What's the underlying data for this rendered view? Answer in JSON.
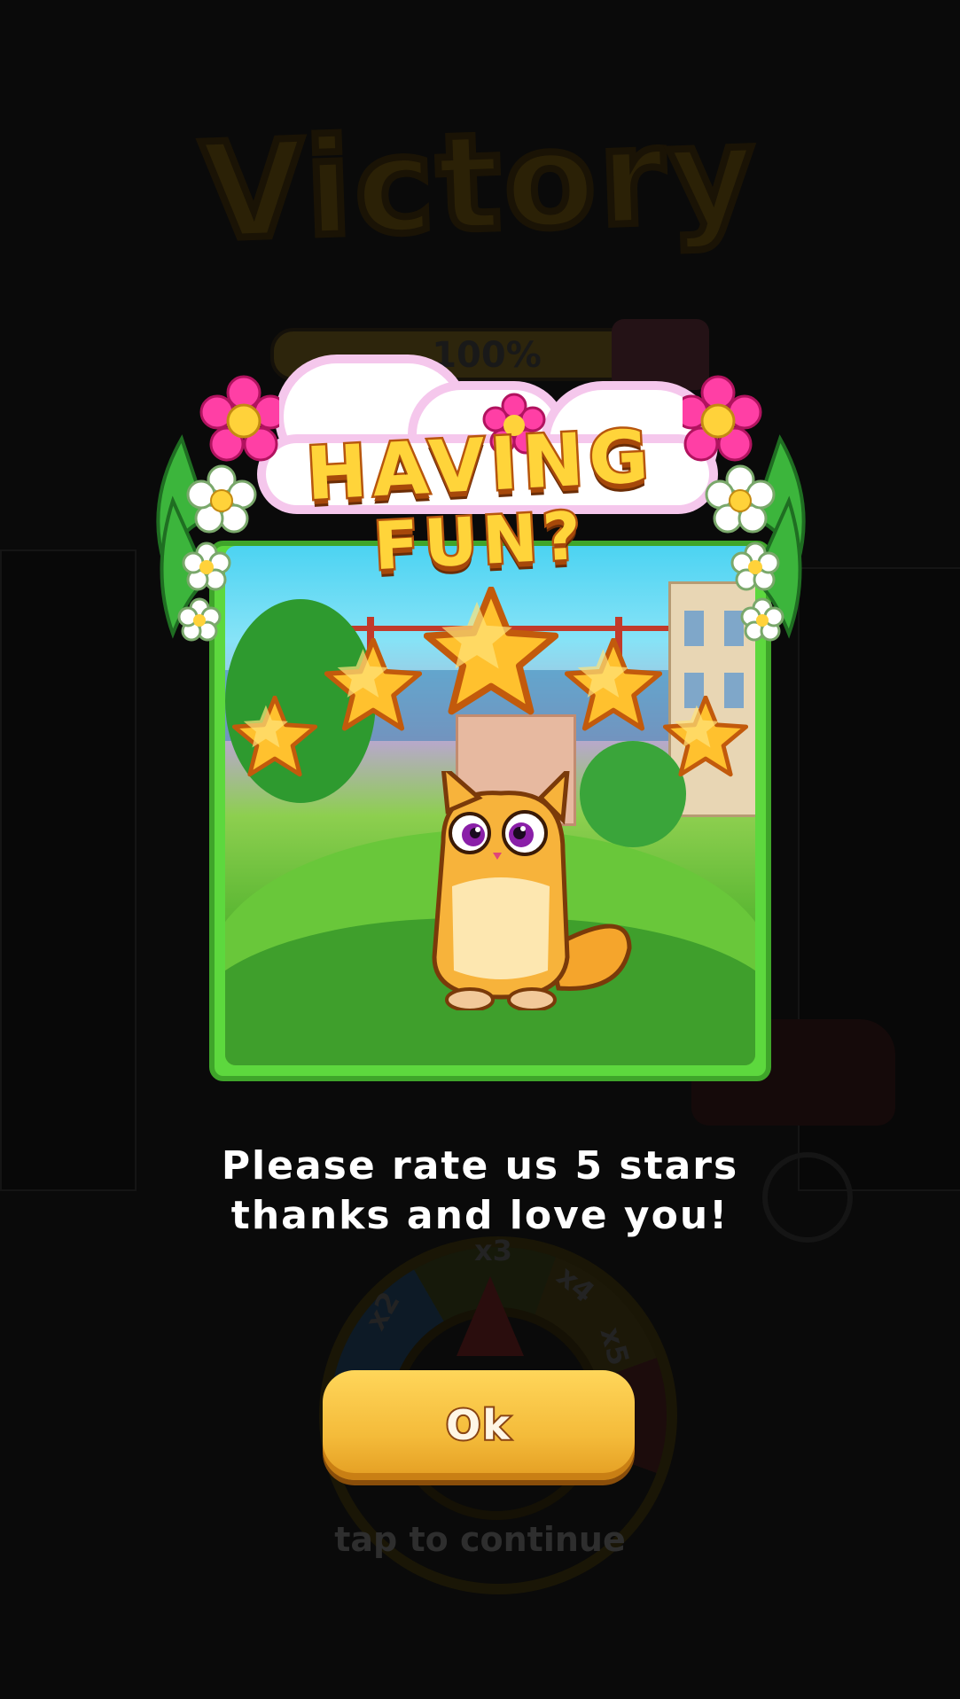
{
  "background": {
    "title": "Victory",
    "progress_label": "100%",
    "progress_value": 1.0,
    "wheel_labels": [
      "x2",
      "x3",
      "x4",
      "x5"
    ],
    "tap_hint": "tap to continue"
  },
  "popup": {
    "title_line_1": "HAVING",
    "title_line_2": "FUN?",
    "rating_stars": 5,
    "message_line_1": "Please rate us 5 stars",
    "message_line_2": "thanks and love you!",
    "ok_label": "Ok"
  },
  "colors": {
    "card_border": "#3fa52a",
    "star_fill": "#ffc12e",
    "button": "#f4bb3a",
    "flower_pink": "#ff3fa5"
  }
}
